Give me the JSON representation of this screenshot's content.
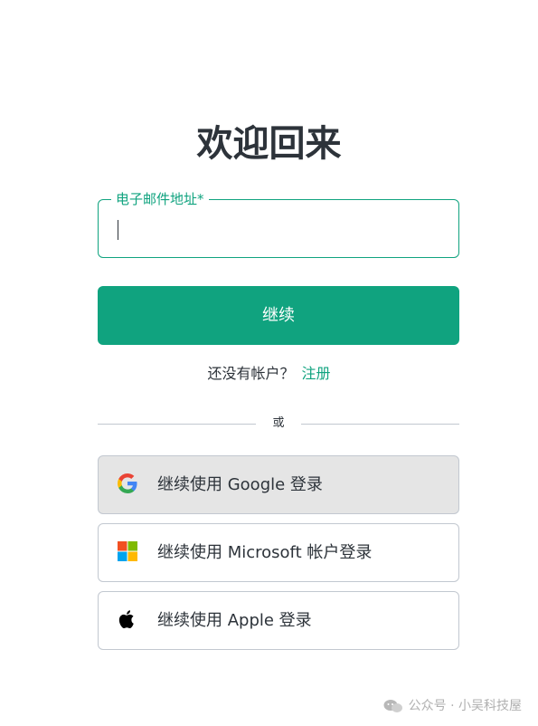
{
  "heading": "欢迎回来",
  "email_field": {
    "label": "电子邮件地址*",
    "value": ""
  },
  "continue_button": "继续",
  "signup": {
    "prompt": "还没有帐户？",
    "link": "注册"
  },
  "divider": "或",
  "social": [
    {
      "label": "继续使用 Google 登录",
      "icon": "google-icon"
    },
    {
      "label": "继续使用 Microsoft 帐户登录",
      "icon": "microsoft-icon"
    },
    {
      "label": "继续使用 Apple 登录",
      "icon": "apple-icon"
    }
  ],
  "watermark": "公众号 · 小吴科技屋",
  "colors": {
    "accent": "#10a37f",
    "text": "#2d333a",
    "border": "#c2c8d0"
  }
}
